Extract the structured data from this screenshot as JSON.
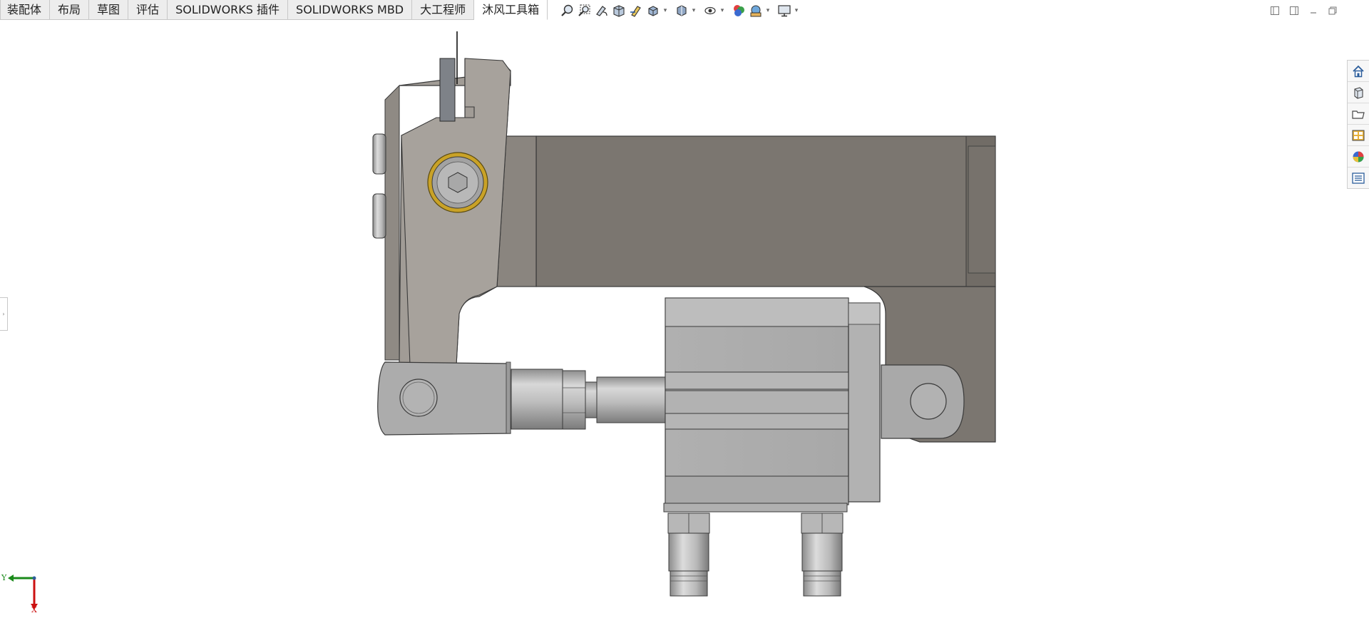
{
  "tabs": [
    {
      "label": "装配体"
    },
    {
      "label": "布局"
    },
    {
      "label": "草图"
    },
    {
      "label": "评估"
    },
    {
      "label": "SOLIDWORKS 插件"
    },
    {
      "label": "SOLIDWORKS MBD"
    },
    {
      "label": "大工程师"
    },
    {
      "label": "沐风工具箱",
      "active": true
    }
  ],
  "view_toolbar": {
    "buttons": [
      "zoom-to-fit-icon",
      "zoom-to-area-icon",
      "previous-view-icon",
      "section-view-icon",
      "dynamic-annotation-icon",
      "view-orientation-icon",
      "display-style-icon",
      "hide-show-items-icon",
      "edit-appearance-icon",
      "apply-scene-icon",
      "view-settings-icon"
    ]
  },
  "task_pane": {
    "buttons": [
      "solidworks-resources-icon",
      "design-library-icon",
      "file-explorer-icon",
      "view-palette-icon",
      "appearances-scenes-icon",
      "custom-properties-icon"
    ]
  },
  "triad": {
    "y_label": "Y",
    "x_label": "X",
    "y_color": "#1a8a1a",
    "x_color": "#cc1111"
  },
  "colors": {
    "body_dark": "#7b7670",
    "body_light": "#a39e98",
    "cylinder": "#b4b4b4",
    "brass_ring": "#c9a227"
  }
}
